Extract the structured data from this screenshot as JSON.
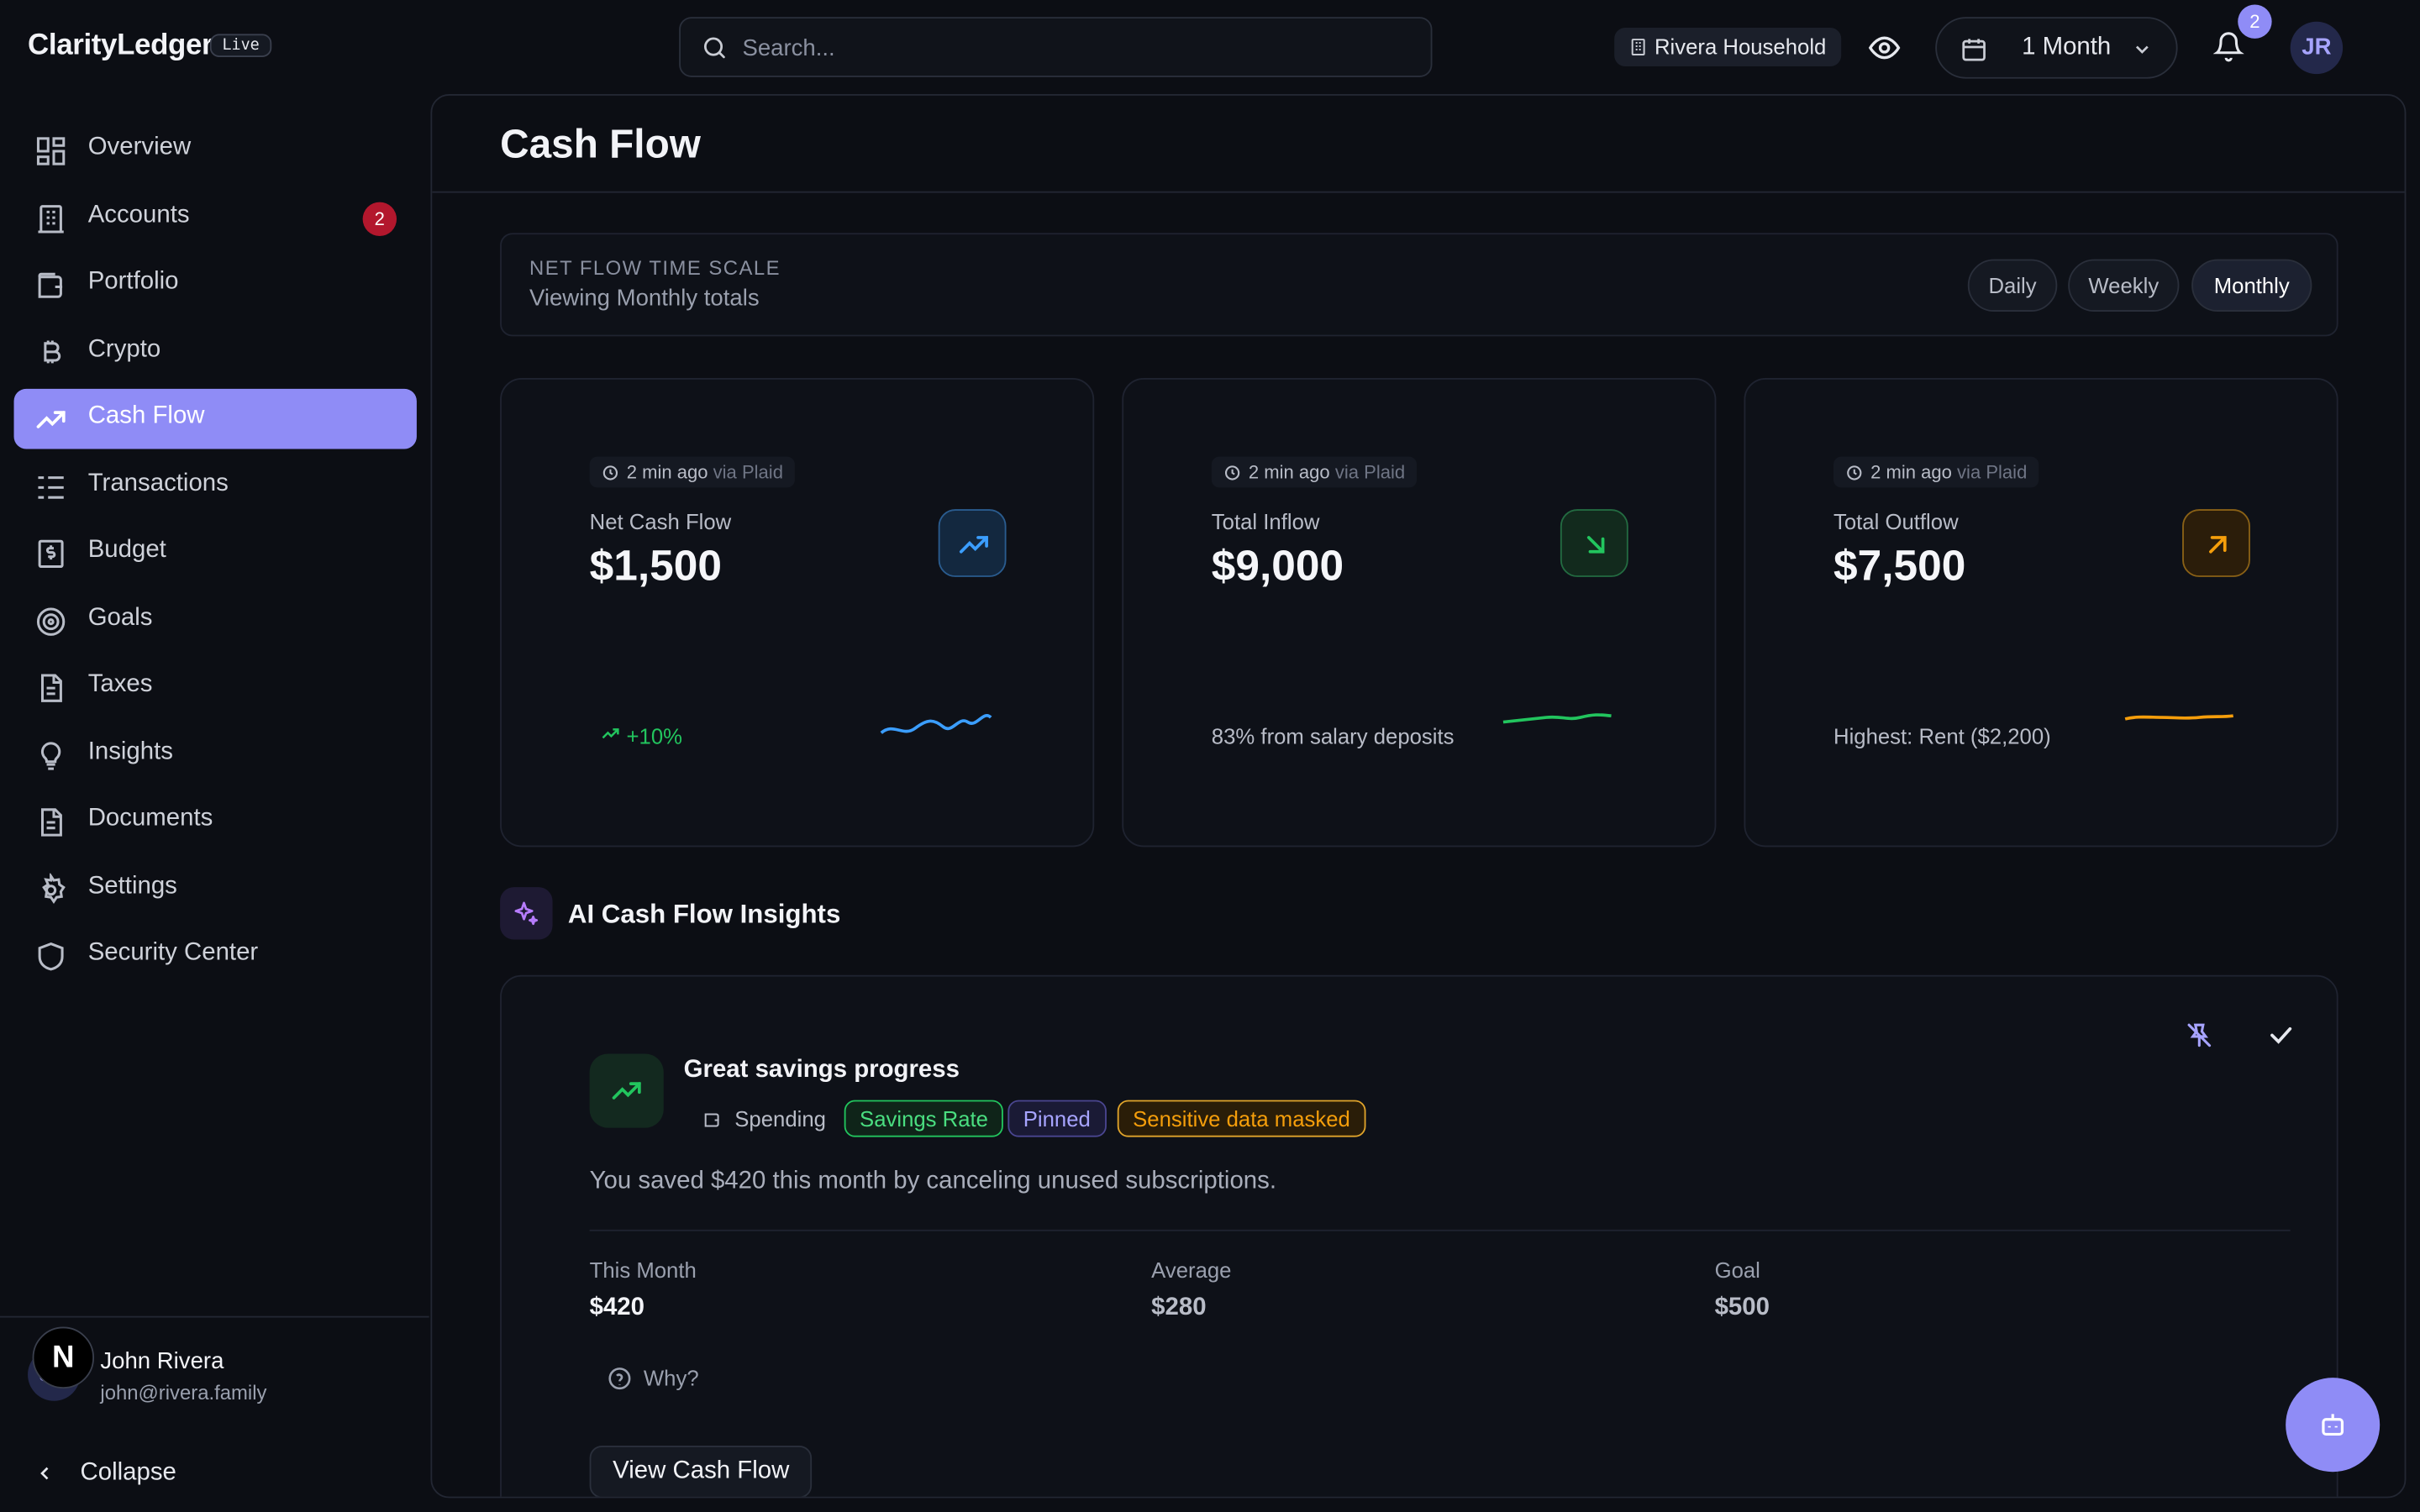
{
  "app": {
    "brand": "ClarityLedger",
    "live_badge": "Live"
  },
  "search": {
    "placeholder": "Search..."
  },
  "header": {
    "household": "Rivera Household",
    "period": "1 Month",
    "notifications_count": "2",
    "avatar_initials": "JR"
  },
  "sidebar": {
    "items": [
      {
        "label": "Overview",
        "icon": "grid-icon"
      },
      {
        "label": "Accounts",
        "icon": "bank-icon",
        "badge": "2"
      },
      {
        "label": "Portfolio",
        "icon": "wallet-icon"
      },
      {
        "label": "Crypto",
        "icon": "bitcoin-icon"
      },
      {
        "label": "Cash Flow",
        "icon": "trending-up-icon",
        "active": true
      },
      {
        "label": "Transactions",
        "icon": "list-icon"
      },
      {
        "label": "Budget",
        "icon": "receipt-icon"
      },
      {
        "label": "Goals",
        "icon": "target-icon"
      },
      {
        "label": "Taxes",
        "icon": "document-icon"
      },
      {
        "label": "Insights",
        "icon": "lightbulb-icon"
      },
      {
        "label": "Documents",
        "icon": "file-icon"
      },
      {
        "label": "Settings",
        "icon": "gear-icon"
      },
      {
        "label": "Security Center",
        "icon": "shield-icon"
      }
    ],
    "user": {
      "initials": "JR",
      "name": "John Rivera",
      "email": "john@rivera.family"
    },
    "collapse_label": "Collapse",
    "dev_badge": "N"
  },
  "page": {
    "title": "Cash Flow"
  },
  "time_scale": {
    "kicker": "NET FLOW TIME SCALE",
    "subtitle": "Viewing Monthly totals",
    "options": [
      "Daily",
      "Weekly",
      "Monthly"
    ],
    "selected": "Monthly"
  },
  "stats": [
    {
      "updated": "2 min ago",
      "source": "via Plaid",
      "label": "Net Cash Flow",
      "value": "$1,500",
      "footer": "+10%",
      "accent": "#3b9eff",
      "icon": "trending-up-icon"
    },
    {
      "updated": "2 min ago",
      "source": "via Plaid",
      "label": "Total Inflow",
      "value": "$9,000",
      "footer": "83% from salary deposits",
      "accent": "#22c55e",
      "icon": "arrow-down-right-icon"
    },
    {
      "updated": "2 min ago",
      "source": "via Plaid",
      "label": "Total Outflow",
      "value": "$7,500",
      "footer": "Highest: Rent ($2,200)",
      "accent": "#f59e0b",
      "icon": "arrow-up-right-icon"
    }
  ],
  "ai": {
    "section_title": "AI Cash Flow Insights",
    "insight": {
      "title": "Great savings progress",
      "category": "Spending",
      "tags": [
        "Savings Rate",
        "Pinned",
        "Sensitive data masked"
      ],
      "body": "You saved $420 this month by canceling unused subscriptions.",
      "metrics": [
        {
          "label": "This Month",
          "value": "$420"
        },
        {
          "label": "Average",
          "value": "$280"
        },
        {
          "label": "Goal",
          "value": "$500"
        }
      ],
      "why_label": "Why?",
      "action_label": "View Cash Flow"
    }
  },
  "colors": {
    "accent": "#8f8cf6",
    "positive": "#22c55e",
    "warning": "#f59e0b",
    "danger": "#b3172d"
  }
}
